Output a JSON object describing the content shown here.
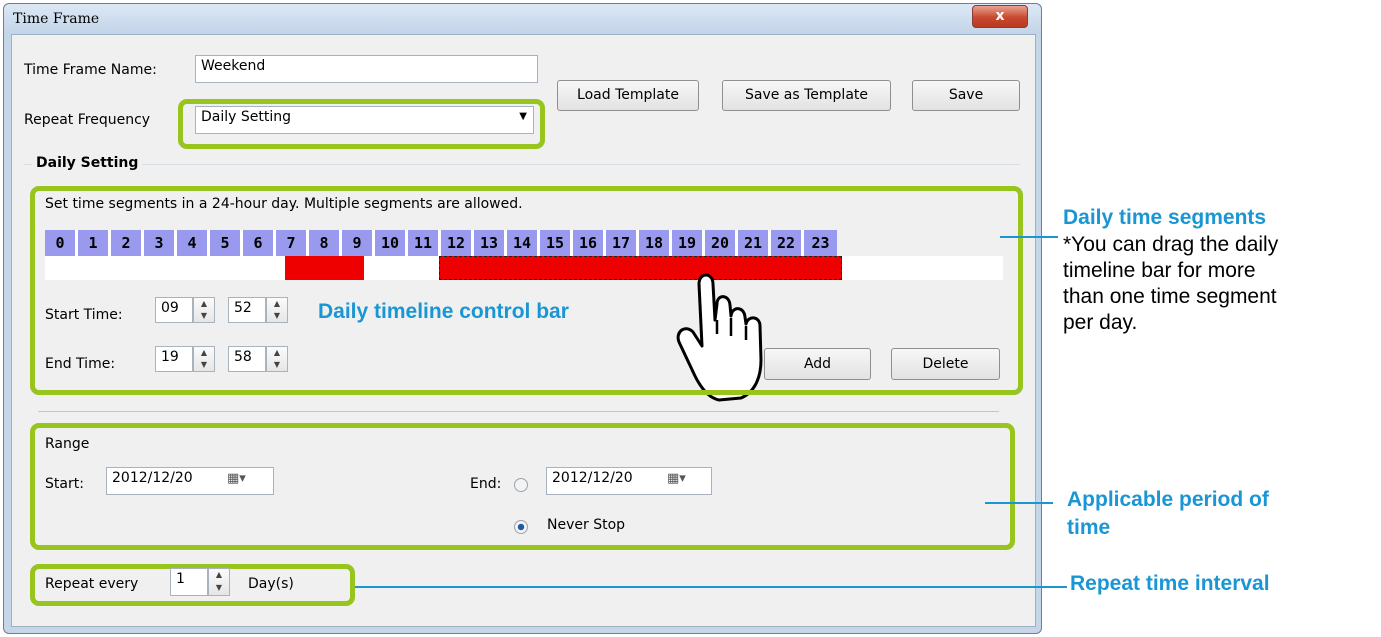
{
  "window": {
    "title": "Time Frame",
    "close_symbol": "x"
  },
  "form": {
    "name_label": "Time Frame Name:",
    "name_value": "Weekend",
    "repeat_label": "Repeat Frequency",
    "repeat_value": "Daily Setting",
    "load_template": "Load Template",
    "save_template": "Save as Template",
    "save": "Save"
  },
  "daily": {
    "group_title": "Daily Setting",
    "instruction": "Set time segments in a 24-hour day. Multiple segments are allowed.",
    "hours": [
      "0",
      "1",
      "2",
      "3",
      "4",
      "5",
      "6",
      "7",
      "8",
      "9",
      "10",
      "11",
      "12",
      "13",
      "14",
      "15",
      "16",
      "17",
      "18",
      "19",
      "20",
      "21",
      "22",
      "23"
    ],
    "segments": [
      {
        "start": 6,
        "end": 8,
        "selected": false
      },
      {
        "start": 9.87,
        "end": 19.97,
        "selected": true
      }
    ],
    "segment_color": "#ee0000",
    "start_label": "Start Time:",
    "start_hour": "09",
    "start_min": "52",
    "end_label": "End Time:",
    "end_hour": "19",
    "end_min": "58",
    "add": "Add",
    "delete": "Delete"
  },
  "range": {
    "title": "Range",
    "start_label": "Start:",
    "start_value": "2012/12/20",
    "end_label": "End:",
    "end_value": "2012/12/20",
    "never_stop": "Never Stop"
  },
  "repeat": {
    "label": "Repeat every",
    "value": "1",
    "unit": "Day(s)"
  },
  "annotations": {
    "control_bar": "Daily timeline control bar",
    "segments_title": "Daily time segments",
    "segments_text": [
      "*You can drag the daily",
      "timeline bar for more",
      "than one time segment",
      "per day."
    ],
    "period_title": [
      "Applicable period of",
      "time"
    ],
    "interval_title": "Repeat time interval",
    "accent_color": "#1a96d4",
    "highlight_color": "#97c41d"
  }
}
